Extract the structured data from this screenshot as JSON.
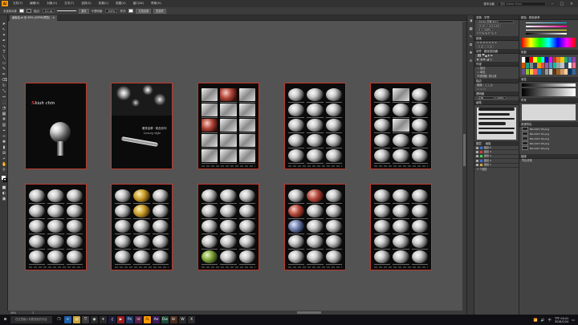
{
  "menubar": {
    "app_logo": "Ai",
    "menus": [
      "文件(F)",
      "编辑(E)",
      "对象(O)",
      "文字(T)",
      "选择(S)",
      "效果(C)",
      "视图(V)",
      "窗口(W)",
      "帮助(H)"
    ],
    "workspace": "基本功能",
    "search_placeholder": "搜索 Adobe Stock",
    "window_min": "–",
    "window_max": "□",
    "window_close": "×"
  },
  "controlbar": {
    "selection_label": "未选择对象",
    "stroke_label": "描边:",
    "stroke_value": "0.1 pt",
    "style_label": "基本",
    "opacity_label": "不透明度:",
    "opacity_value": "100%",
    "style2_label": "样式:",
    "doc_setup": "文档设置",
    "prefs": "首选项"
  },
  "document": {
    "tab_title": "画板绘.ai @ 49% (CMYK/预览)",
    "close": "×"
  },
  "status": {
    "zoom": "49%",
    "page": "1"
  },
  "artboards": [
    {
      "kind": "cover1",
      "title_red": "X",
      "title": "kiah chin"
    },
    {
      "kind": "cover2",
      "title": "奢侈品牌 · 精品系列",
      "subtitle": "Luxury style"
    },
    {
      "kind": "grid",
      "mode": "squares"
    },
    {
      "kind": "grid",
      "mode": "knobs"
    },
    {
      "kind": "grid",
      "mode": "mixed"
    },
    {
      "kind": "grid",
      "mode": "knobs"
    },
    {
      "kind": "grid",
      "mode": "gold"
    },
    {
      "kind": "grid",
      "mode": "green"
    },
    {
      "kind": "grid",
      "mode": "red"
    },
    {
      "kind": "grid",
      "mode": "knobs"
    }
  ],
  "panels": {
    "color_tab": "颜色",
    "color_guide_tab": "颜色参考",
    "transform_tab": "变换",
    "char_tab": "字符",
    "char_font": "Adobe 宋体 Std L",
    "char_size": "12 pt",
    "char_leading": "(14.4 pt)",
    "char_tracking": "0",
    "char_scale": "100%",
    "paragraph_tab": "段落",
    "align_tab": "对齐",
    "pathfinder_tab": "路径查找器",
    "appearance_tab": "外观",
    "stroke_tab": "描边",
    "stroke_weight_label": "粗细:",
    "transparency_tab": "透明度",
    "brushes_tab": "画笔",
    "swatches_tab": "色板",
    "gradient_tab": "渐变",
    "symbols_tab": "符号",
    "layers_tab": "图层",
    "artboards_tab": "画板",
    "links_tab": "链接",
    "layers": [
      {
        "name": "图层 5",
        "color": "#3b6ed8"
      },
      {
        "name": "图层 4",
        "color": "#d83b3b"
      },
      {
        "name": "图层 3",
        "color": "#3bd85a"
      },
      {
        "name": "图层 2",
        "color": "#3b6ed8"
      },
      {
        "name": "图层 1",
        "color": "#d8a33b"
      }
    ],
    "layers_count": "5 个图层",
    "assets": [
      {
        "name": "NK-1027-03.png"
      },
      {
        "name": "NK-1027-01.png"
      },
      {
        "name": "NK-1027-02.png"
      },
      {
        "name": "NK-1027-05.png"
      },
      {
        "name": "NK-1027-04.png"
      }
    ],
    "export_label": "资源导出",
    "export_hint": "导出资源",
    "swatch_colors": [
      "#ffffff",
      "#000000",
      "#ff0000",
      "#ffff00",
      "#00ff00",
      "#00ffff",
      "#0000ff",
      "#ff00ff",
      "#c0392b",
      "#e67e22",
      "#f1c40f",
      "#27ae60",
      "#2980b9",
      "#8e44ad",
      "#d35400",
      "#16a085",
      "#7f8c8d",
      "#2c3e50",
      "#f39c12",
      "#e74c3c",
      "#9b59b6",
      "#3498db",
      "#1abc9c",
      "#95a5a6",
      "#bdc3c7",
      "#34495e",
      "#ecf0f1",
      "#ff6f91",
      "#6a4c93",
      "#8ac926",
      "#ffca3a",
      "#ff595e",
      "#1982c4",
      "#4d4d4d",
      "#999999",
      "#cccccc",
      "#663300",
      "#996633",
      "#cc9966",
      "#ffcc99",
      "#003366",
      "#336699"
    ]
  },
  "taskbar": {
    "search_placeholder": "在这里输入你要搜索的内容",
    "time": "下午 04:41",
    "date": "2018/1/24",
    "lang": "中"
  }
}
